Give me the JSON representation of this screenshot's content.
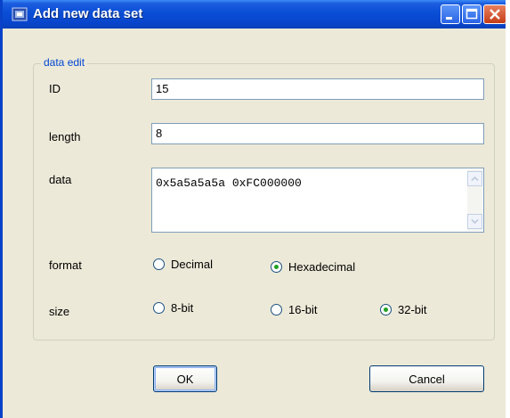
{
  "window": {
    "title": "Add new data set"
  },
  "group": {
    "legend": "data edit"
  },
  "fields": {
    "id": {
      "label": "ID",
      "value": "15"
    },
    "length": {
      "label": "length",
      "value": "8"
    },
    "data": {
      "label": "data",
      "value": "0x5a5a5a5a 0xFC000000"
    }
  },
  "format": {
    "label": "format",
    "options": [
      "Decimal",
      "Hexadecimal"
    ],
    "selected": "Hexadecimal"
  },
  "size": {
    "label": "size",
    "options": [
      "8-bit",
      "16-bit",
      "32-bit"
    ],
    "selected": "32-bit"
  },
  "buttons": {
    "ok": "OK",
    "cancel": "Cancel"
  },
  "colors": {
    "titlebar": "#0a4ed6",
    "face": "#ece9d8",
    "group_legend": "#0046d5",
    "radio_dot": "#21a121"
  }
}
